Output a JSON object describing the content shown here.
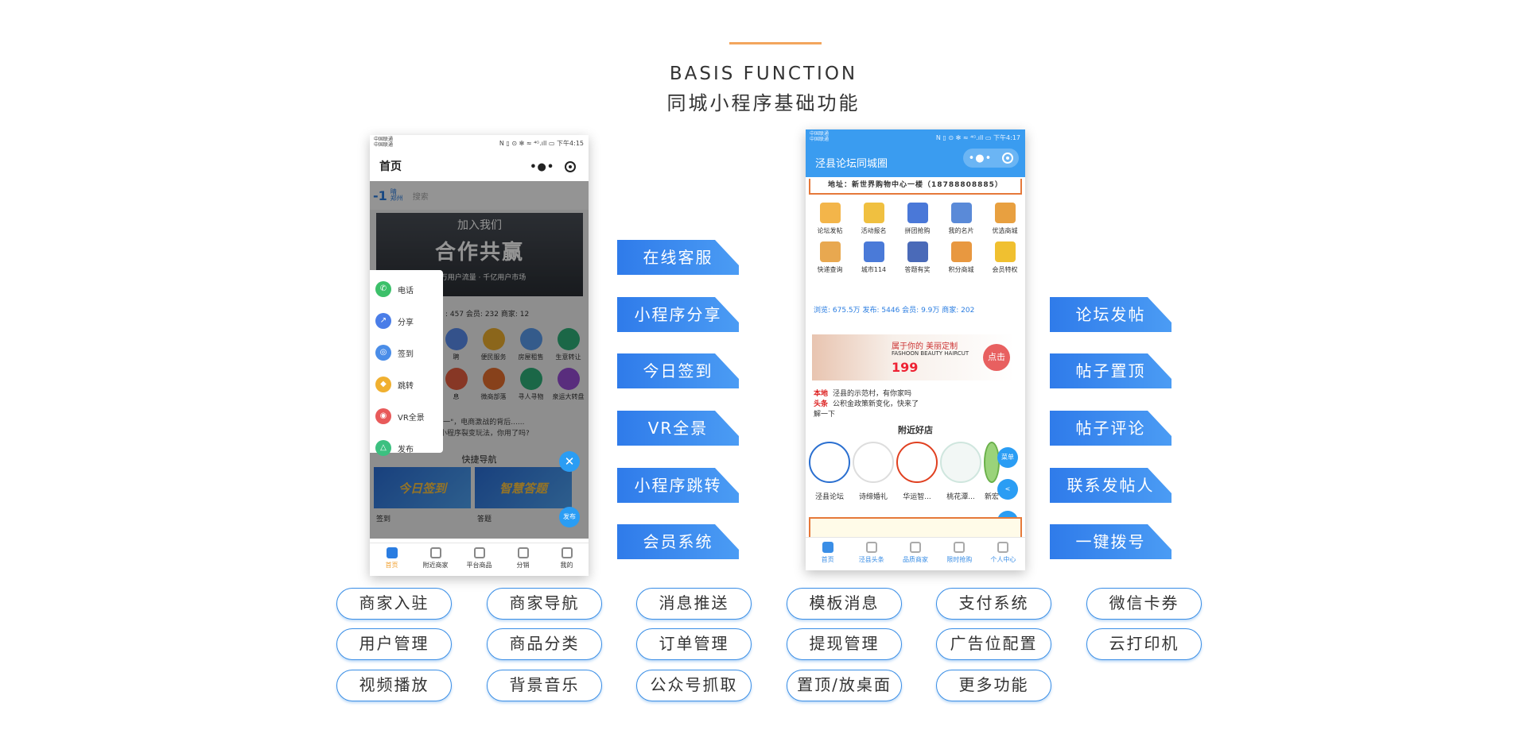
{
  "header": {
    "en_title": "BASIS FUNCTION",
    "cn_title": "同城小程序基础功能"
  },
  "phone1": {
    "carrier": "中国联通\n中国联通",
    "status_right": "N ▯ ⊙ ✻ ≈ ⁴ᴳ.ıll ▭ 下午4:15",
    "title": "首页",
    "search_wx": "-1",
    "search_city": "晴\n郑州",
    "search_placeholder": "搜索",
    "banner": {
      "line1": "加入我们",
      "line2": "合作共赢",
      "line3": "百万用户流量 · 千亿用户市场"
    },
    "stats": ": 457  会员: 232  商家: 12",
    "icons": [
      "聘",
      "便民服务",
      "房屋租售",
      "生意转让",
      "息",
      "微商部落",
      "寻人寻物",
      "泉运大转盘"
    ],
    "news": [
      "\"双十一\"，电商激战的背后......",
      "评的小程序裂变玩法，你用了吗?"
    ],
    "quick_title": "快捷导航",
    "quick_cards": [
      "今日签到",
      "智慧答题"
    ],
    "quick_labels": [
      "签到",
      "答题"
    ],
    "menu": [
      "电话",
      "分享",
      "签到",
      "跳转",
      "VR全景",
      "发布"
    ],
    "close": "✕",
    "fab": "发布",
    "tabs": [
      "首页",
      "附近商家",
      "平台商品",
      "分销",
      "我的"
    ]
  },
  "phone2": {
    "carrier": "中国联通\n中国联通",
    "status_right": "N ▯ ⊙ ✻ ≈ ⁴ᴳ.ıll ▭ 下午4:17",
    "title": "泾县论坛同城圈",
    "address": "地址：新世界购物中心一楼（18788808885）",
    "icons": [
      "论坛发帖",
      "活动报名",
      "拼团抢购",
      "我的名片",
      "优选商城",
      "快递查询",
      "城市114",
      "答题有奖",
      "积分商城",
      "会员特权"
    ],
    "stats": "浏览: 675.5万  发布: 5446  会员: 9.9万  商家: 202",
    "ad": {
      "t1": "属于你的 美丽定制",
      "t2": "FASHOON BEAUTY HAIRCUT",
      "t3": "199",
      "btn": "点击"
    },
    "headline_tag": "本地\n头条",
    "headlines": [
      "泾县的示范村，有你家吗",
      "公积金政策新变化，快来了解一下"
    ],
    "nearby_title": "附近好店",
    "shops": [
      "泾县论坛",
      "诗缔婚礼",
      "华运智...",
      "桃花潭...",
      "新宏"
    ],
    "fabs": [
      "菜单",
      "<",
      "发布"
    ],
    "tabs": [
      "首页",
      "泾县头条",
      "品质商家",
      "限时抢购",
      "个人中心"
    ]
  },
  "features_left": [
    "在线客服",
    "小程序分享",
    "今日签到",
    "VR全景",
    "小程序跳转",
    "会员系统"
  ],
  "features_right": [
    "论坛发帖",
    "帖子置顶",
    "帖子评论",
    "联系发帖人",
    "一键拨号"
  ],
  "pills": [
    [
      "商家入驻",
      "商家导航",
      "消息推送",
      "模板消息",
      "支付系统",
      "微信卡券"
    ],
    [
      "用户管理",
      "商品分类",
      "订单管理",
      "提现管理",
      "广告位配置",
      "云打印机"
    ],
    [
      "视频播放",
      "背景音乐",
      "公众号抓取",
      "置顶/放桌面",
      "更多功能"
    ]
  ],
  "colors": {
    "accent_line": "#f3a55d",
    "ribbon_blue": "#3a8ee6",
    "pill_border": "#3a8ee6"
  }
}
